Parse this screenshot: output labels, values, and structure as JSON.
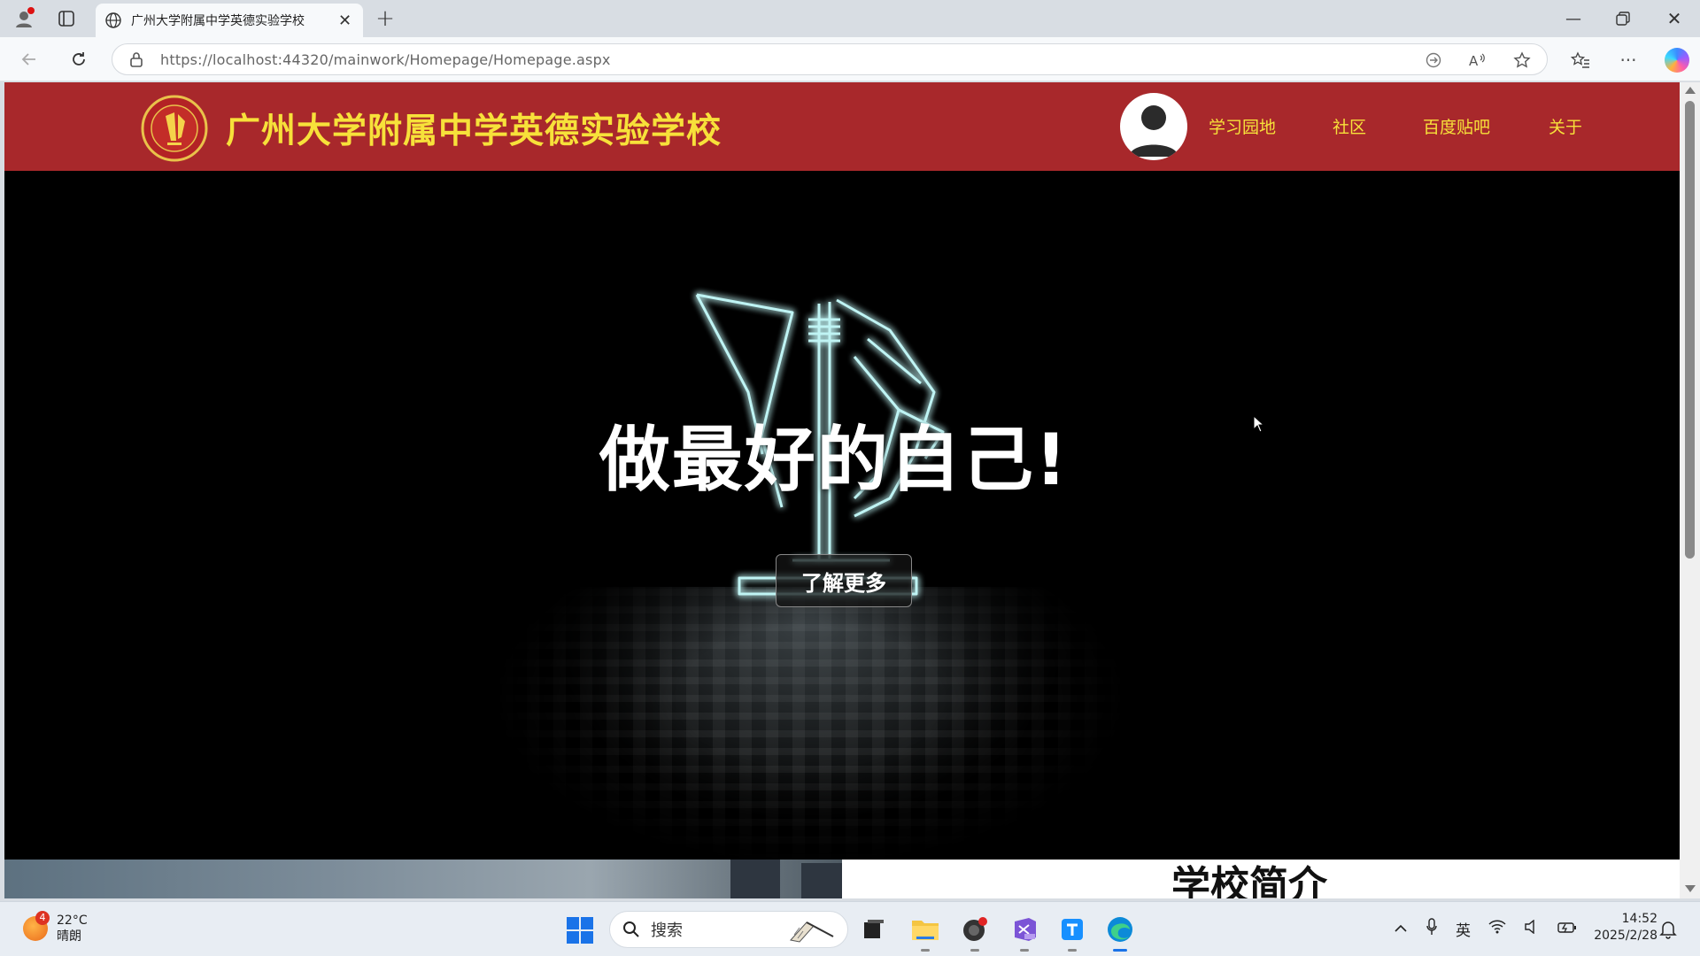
{
  "browser": {
    "tab_title": "广州大学附属中学英德实验学校",
    "url": "https://localhost:44320/mainwork/Homepage/Homepage.aspx"
  },
  "site": {
    "school_name": "广州大学附属中学英德实验学校",
    "nav": [
      "学习园地",
      "社区",
      "百度贴吧",
      "关于"
    ],
    "hero_slogan": "做最好的自己!",
    "learn_more_label": "了解更多",
    "intro_heading": "学校简介",
    "colors": {
      "header_bg": "#a8282b",
      "header_text": "#f7e13a"
    }
  },
  "taskbar": {
    "weather_badge": "4",
    "weather_temp": "22°C",
    "weather_desc": "晴朗",
    "search_placeholder": "搜索",
    "ime": "英",
    "time": "14:52",
    "date": "2025/2/28"
  }
}
